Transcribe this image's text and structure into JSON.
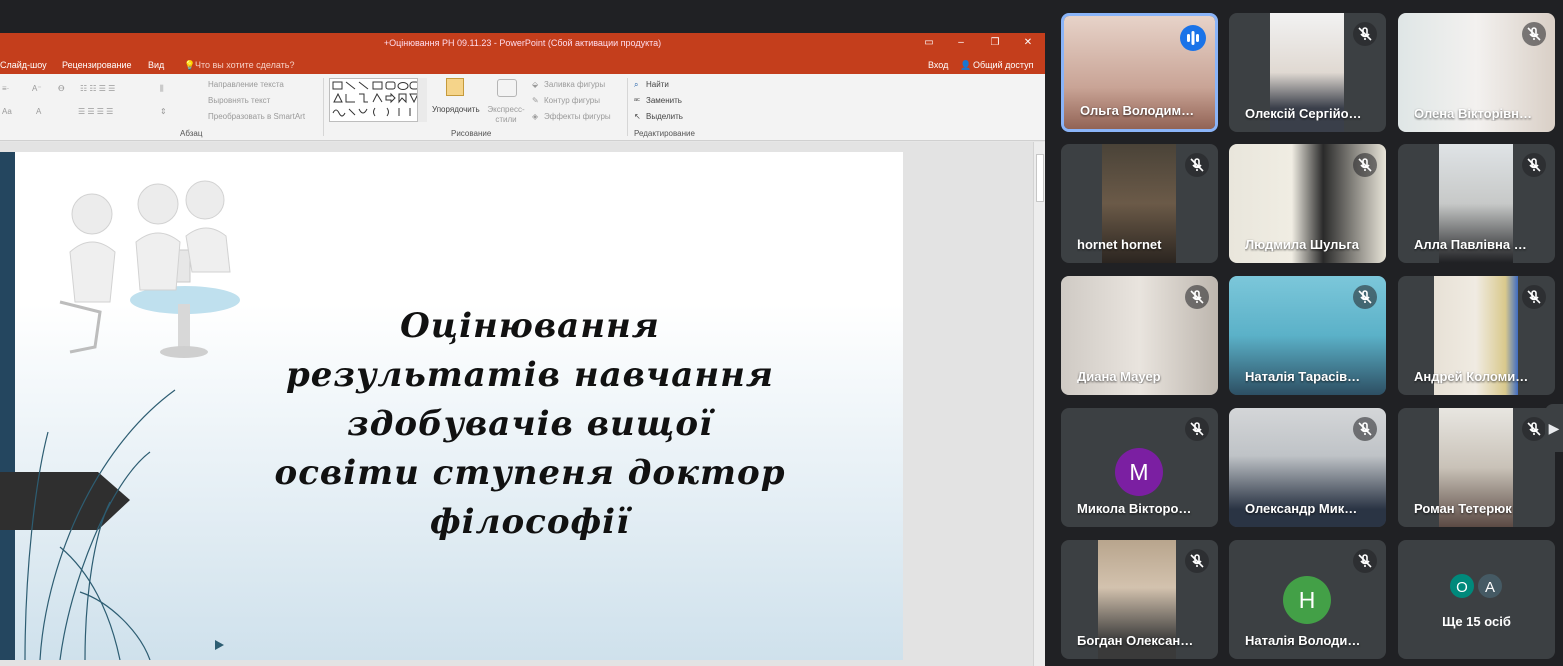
{
  "ppt": {
    "window_title": "+Оцінювання РН 09.11.23 - PowerPoint (Сбой активации продукта)",
    "menu": {
      "slideshow": "Слайд-шоу",
      "review": "Рецензирование",
      "view": "Вид",
      "tellme": "Что вы хотите сделать?",
      "signin": "Вход",
      "share": "Общий доступ"
    },
    "ribbon": {
      "text_direction": "Направление текста",
      "align_text": "Выровнять текст",
      "smartart": "Преобразовать в SmartArt",
      "paragraph_group": "Абзац",
      "arrange": "Упорядочить",
      "quick_styles": "Экспресс-стили",
      "shape_fill": "Заливка фигуры",
      "shape_outline": "Контур фигуры",
      "shape_effects": "Эффекты фигуры",
      "drawing_group": "Рисование",
      "find": "Найти",
      "replace": "Заменить",
      "select": "Выделить",
      "editing_group": "Редактирование"
    },
    "slide": {
      "title_lines": [
        "Оцінювання",
        "результатів навчання",
        "здобувачів вищої",
        "освіти ступеня доктор",
        "філософії"
      ]
    }
  },
  "meet": {
    "tiles": [
      {
        "name": "Ольга Володим…",
        "active": true
      },
      {
        "name": "Олексій Сергійо…"
      },
      {
        "name": "Олена Вікторівн…"
      },
      {
        "name": "hornet hornet"
      },
      {
        "name": "Людмила Шульга"
      },
      {
        "name": "Алла Павлівна …"
      },
      {
        "name": "Диана Мауер"
      },
      {
        "name": "Наталія Тарасів…"
      },
      {
        "name": "Андрей Коломи…"
      },
      {
        "name": "Микола Вікторо…",
        "initial": "М"
      },
      {
        "name": "Олександр Мик…"
      },
      {
        "name": "Роман Тетерюк"
      },
      {
        "name": "Богдан Олексан…"
      },
      {
        "name": "Наталія Володи…",
        "initial": "Н"
      }
    ],
    "more": {
      "initials": [
        "О",
        "А"
      ],
      "label": "Ще 15 осіб"
    }
  },
  "colors": {
    "ppt_accent": "#c43e1c",
    "meet_bg": "#202124",
    "tile_bg": "#3c4043",
    "active_border": "#8ab4f8",
    "speaking": "#1a73e8",
    "avatar_m": "#7b1fa2",
    "avatar_n": "#43a047",
    "avatar_o": "#00897b",
    "avatar_a": "#455a64"
  }
}
